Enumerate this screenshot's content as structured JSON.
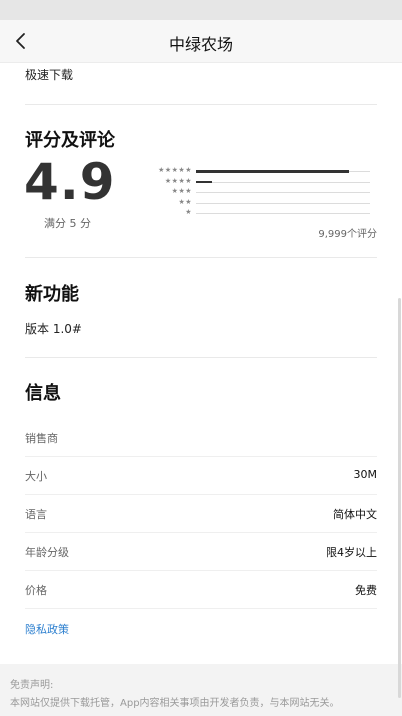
{
  "header": {
    "title": "中绿农场",
    "back_icon": "chevron-left-icon"
  },
  "download": {
    "label": "极速下载"
  },
  "ratings": {
    "heading": "评分及评论",
    "score": "4.9",
    "out_of": "满分 5 分",
    "count": "9,999个评分",
    "distribution": [
      {
        "stars": "★★★★★",
        "fraction": 0.88
      },
      {
        "stars": "★★★★",
        "fraction": 0.09
      },
      {
        "stars": "★★★",
        "fraction": 0.0
      },
      {
        "stars": "★★",
        "fraction": 0.0
      },
      {
        "stars": "★",
        "fraction": 0.0
      }
    ]
  },
  "whats_new": {
    "heading": "新功能",
    "version": "版本 1.0#"
  },
  "info": {
    "heading": "信息",
    "rows": [
      {
        "label": "销售商",
        "value": ""
      },
      {
        "label": "大小",
        "value": "30M"
      },
      {
        "label": "语言",
        "value": "简体中文"
      },
      {
        "label": "年龄分级",
        "value": "限4岁以上"
      },
      {
        "label": "价格",
        "value": "免费"
      }
    ],
    "privacy": "隐私政策"
  },
  "footer": {
    "title": "免责声明:",
    "text": "本网站仅提供下载托管，App内容相关事项由开发者负责，与本网站无关。"
  }
}
